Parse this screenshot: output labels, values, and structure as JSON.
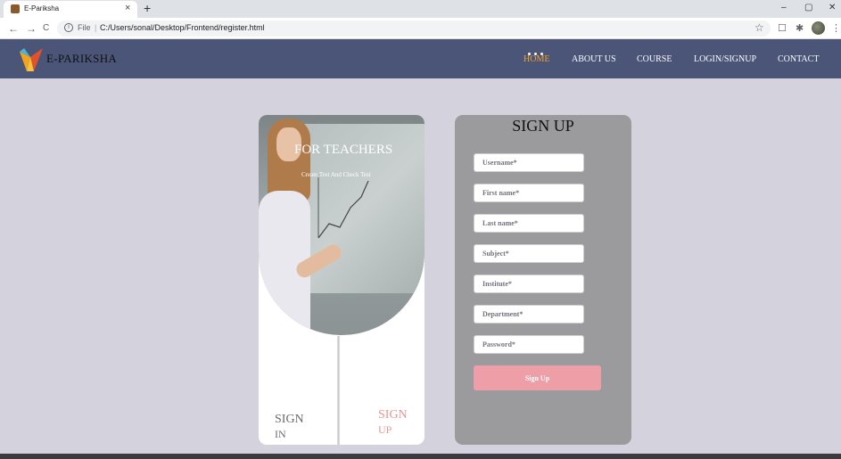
{
  "browser": {
    "tab_title": "E-Pariksha",
    "tab_close": "×",
    "new_tab": "+",
    "file_label": "File",
    "separator": "|",
    "url": "C:/Users/sonal/Desktop/Frontend/register.html",
    "window_controls": [
      "–",
      "▢",
      "✕"
    ]
  },
  "navbar": {
    "brand": "E-PARIKSHA",
    "links": [
      {
        "label": "HOME",
        "active": true
      },
      {
        "label": "ABOUT US",
        "active": false
      },
      {
        "label": "COURSE",
        "active": false
      },
      {
        "label": "LOGIN/SIGNUP",
        "active": false
      },
      {
        "label": "CONTACT",
        "active": false
      }
    ],
    "active_color": "#f0a030",
    "background": "#4a5578"
  },
  "left_card": {
    "heading": "FOR TEACHERS",
    "subheading": "Create Test And Check Test",
    "sign_in": {
      "line1": "SIGN",
      "line2": "IN"
    },
    "sign_up": {
      "line1": "SIGN",
      "line2": "UP"
    }
  },
  "form": {
    "title": "SIGN UP",
    "fields": [
      {
        "name": "username",
        "placeholder": "Username*",
        "value": ""
      },
      {
        "name": "first-name",
        "placeholder": "First name*",
        "value": ""
      },
      {
        "name": "last-name",
        "placeholder": "Last name*",
        "value": ""
      },
      {
        "name": "subject",
        "placeholder": "Subject*",
        "value": ""
      },
      {
        "name": "institute",
        "placeholder": "Institute*",
        "value": ""
      },
      {
        "name": "department",
        "placeholder": "Department*",
        "value": ""
      },
      {
        "name": "password",
        "placeholder": "Password*",
        "value": ""
      }
    ],
    "submit_label": "Sign Up",
    "submit_color": "#ee9ea6"
  },
  "icons": {
    "back": "←",
    "forward": "→",
    "reload": "C",
    "info": "i",
    "star": "☆",
    "extension": "☐",
    "puzzle": "✱",
    "menu": "⋮"
  }
}
